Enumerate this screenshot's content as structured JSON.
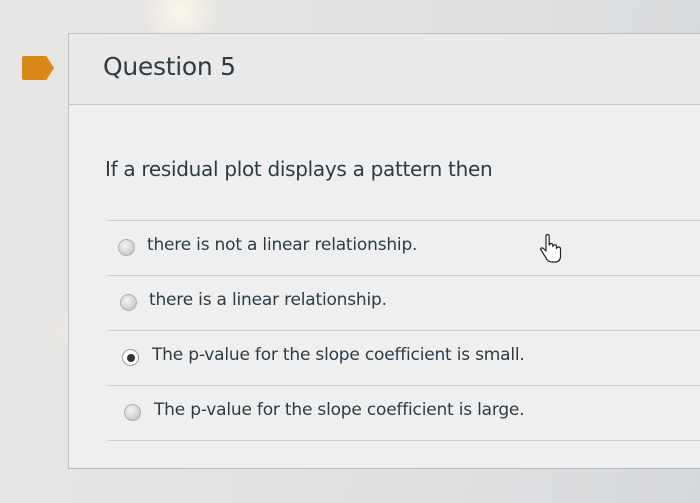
{
  "question": {
    "title": "Question 5",
    "prompt": "If a residual plot displays a pattern then",
    "answers": [
      {
        "label": "there is not a linear relationship.",
        "selected": false
      },
      {
        "label": "there is a linear relationship.",
        "selected": false
      },
      {
        "label": "The p-value for the slope coefficient is small.",
        "selected": true
      },
      {
        "label": "The p-value for the slope coefficient is large.",
        "selected": false
      }
    ]
  },
  "icons": {
    "bookmark": "bookmark-flag-icon",
    "cursor": "hand-pointer-cursor-icon"
  },
  "colors": {
    "bookmark": "#d98a16",
    "text": "#2d3b45"
  }
}
